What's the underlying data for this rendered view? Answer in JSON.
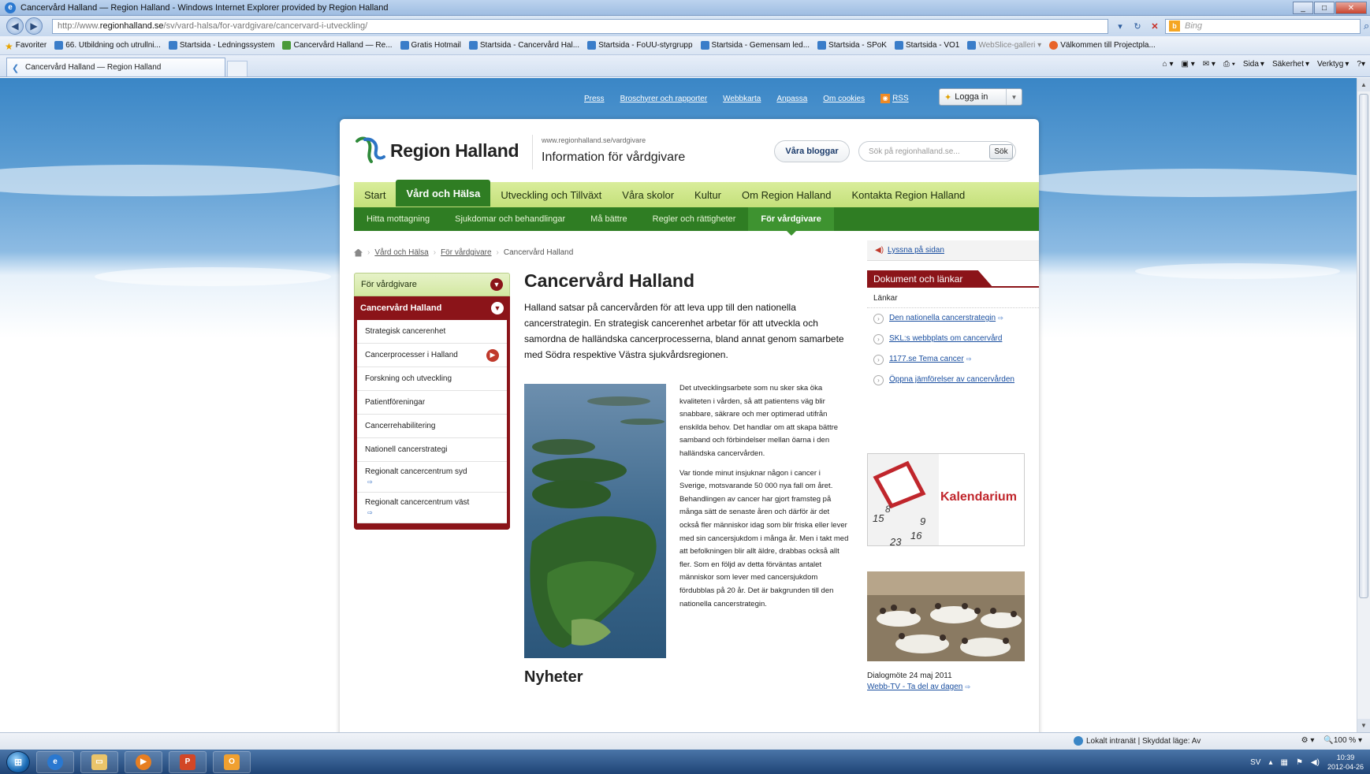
{
  "window": {
    "title": "Cancervård Halland — Region Halland - Windows Internet Explorer provided by Region Halland"
  },
  "address": {
    "prefix": "http://www.",
    "host": "regionhalland.se",
    "path": "/sv/vard-halsa/for-vardgivare/cancervard-i-utveckling/",
    "search_placeholder": "Bing"
  },
  "favorites": {
    "label": "Favoriter",
    "items": [
      "66. Utbildning och utrullni...",
      "Startsida - Ledningssystem",
      "Cancervård Halland — Re...",
      "Gratis Hotmail",
      "Startsida - Cancervård Hal...",
      "Startsida - FoUU-styrgrupp",
      "Startsida - Gemensam led...",
      "Startsida - SPoK",
      "Startsida - VO1",
      "WebSlice-galleri",
      "Välkommen till Projectpla..."
    ]
  },
  "tab": {
    "label": "Cancervård Halland — Region Halland"
  },
  "commandbar": {
    "page": "Sida",
    "safety": "Säkerhet",
    "tools": "Verktyg"
  },
  "topnav": {
    "items": [
      "Press",
      "Broschyrer och rapporter",
      "Webbkarta",
      "Anpassa",
      "Om cookies"
    ],
    "rss": "RSS",
    "login": "Logga in"
  },
  "header": {
    "logo_text": "Region Halland",
    "site_url": "www.regionhalland.se/vardgivare",
    "site_title": "Information för vårdgivare",
    "blog_button": "Våra bloggar",
    "search_placeholder": "Sök på regionhalland.se...",
    "search_button": "Sök"
  },
  "mainnav": {
    "items": [
      "Start",
      "Vård och Hälsa",
      "Utveckling och Tillväxt",
      "Våra skolor",
      "Kultur",
      "Om Region Halland",
      "Kontakta Region Halland"
    ]
  },
  "subnav": {
    "items": [
      "Hitta mottagning",
      "Sjukdomar och behandlingar",
      "Må bättre",
      "Regler och rättigheter",
      "För vårdgivare"
    ]
  },
  "breadcrumb": {
    "items": [
      "Vård och Hälsa",
      "För vårdgivare",
      "Cancervård Halland"
    ]
  },
  "listen": {
    "label": "Lyssna på sidan"
  },
  "leftmenu": {
    "parent": "För vårdgivare",
    "current": "Cancervård Halland",
    "children": [
      "Strategisk cancerenhet",
      "Cancerprocesser i Halland",
      "Forskning och utveckling",
      "Patientföreningar",
      "Cancerrehabilitering",
      "Nationell cancerstrategi",
      "Regionalt cancercentrum syd",
      "Regionalt cancercentrum väst"
    ]
  },
  "content": {
    "title": "Cancervård Halland",
    "ingress": "Halland satsar på cancervården för att leva upp till den nationella cancerstrategin. En strategisk cancerenhet arbetar för att utveckla och samordna de halländska cancerprocesserna, bland annat genom samarbete med Södra respektive Västra sjukvårdsregionen.",
    "paragraph1": "Det utvecklingsarbete som nu sker ska öka kvaliteten i vården, så att patientens väg blir snabbare, säkrare och mer optimerad utifrån enskilda behov. Det handlar om att skapa bättre samband och förbindelser mellan öarna i den halländska cancervården.",
    "paragraph2": "Var tionde minut insjuknar någon i cancer i Sverige, motsvarande 50 000 nya fall om året. Behandlingen av cancer har gjort framsteg på många sätt de senaste åren och därför är det också fler människor idag som blir friska eller lever med sin cancersjukdom i många år. Men i takt med att befolkningen blir allt äldre, drabbas också allt fler. Som en följd av detta förväntas antalet människor som lever med cancersjukdom fördubblas på 20 år. Det är bakgrunden till den nationella cancerstrategin.",
    "news_heading": "Nyheter"
  },
  "documents": {
    "heading": "Dokument och länkar",
    "subheading": "Länkar",
    "links": [
      "Den nationella cancerstrategin",
      "SKL:s webbplats om cancervård",
      "1177.se Tema cancer",
      "Öppna jämförelser av cancervården"
    ]
  },
  "kalendarium": {
    "title": "Kalendarium",
    "numbers": [
      "15",
      "9",
      "16",
      "23",
      "8"
    ]
  },
  "meeting": {
    "caption": "Dialogmöte 24 maj 2011",
    "link": "Webb-TV - Ta del av dagen"
  },
  "statusbar": {
    "zone": "Lokalt intranät | Skyddat läge: Av",
    "zoom": "100 %"
  },
  "taskbar": {
    "lang": "SV",
    "time": "10:39",
    "date": "2012-04-26"
  }
}
